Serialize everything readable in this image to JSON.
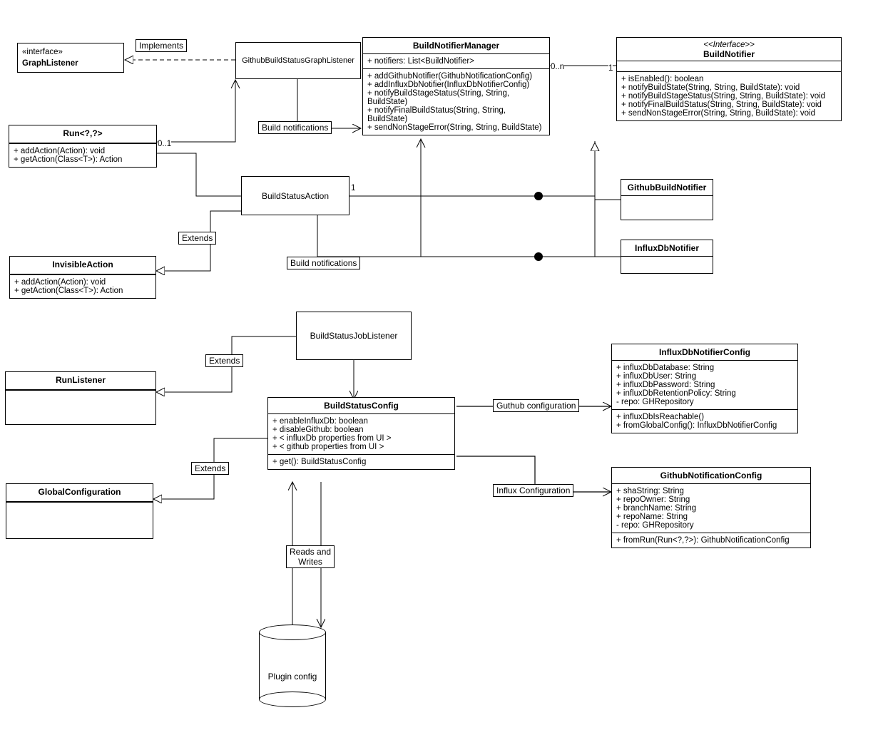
{
  "graphListener": {
    "stereo": "«interface»",
    "name": "GraphListener"
  },
  "implements": "Implements",
  "ghGraphListener": "GithubBuildStatusGraphListener",
  "buildNotifierManager": {
    "name": "BuildNotifierManager",
    "attrs": "+ notifiers: List<BuildNotifier>",
    "ops": [
      "+ addGithubNotifier(GithubNotificationConfig)",
      "+ addInfluxDbNotifier(InfluxDbNotifierConfig)",
      "+ notifyBuildStageStatus(String, String, BuildState)",
      "+ notifyFinalBuildStatus(String, String, BuildState)",
      "+ sendNonStageError(String, String, BuildState)"
    ]
  },
  "multiplicity": {
    "bnmRight": "0..n",
    "bnLeft": "1",
    "bsaRight": "1",
    "runRight": "0..1"
  },
  "buildNotifier": {
    "stereo": "<<Interface>>",
    "name": "BuildNotifier",
    "ops": [
      "+ isEnabled(): boolean",
      "+ notifyBuildState(String, String, BuildState): void",
      "+ notifyBuildStageStatus(String, String, BuildState): void",
      "+ notifyFinalBuildStatus(String, String, BuildState): void",
      "+ sendNonStageError(String, String, BuildState): void"
    ]
  },
  "run": {
    "name": "Run<?,?>",
    "ops": [
      "+ addAction(Action): void",
      "+ getAction(Class<T>): Action"
    ]
  },
  "buildNotifications": "Build notifications",
  "buildStatusAction": "BuildStatusAction",
  "githubBuildNotifier": "GithubBuildNotifier",
  "influxDbNotifier": "InfluxDbNotifier",
  "invisibleAction": {
    "name": "InvisibleAction",
    "ops": [
      "+ addAction(Action): void",
      "+ getAction(Class<T>): Action"
    ]
  },
  "extends": "Extends",
  "buildStatusJobListener": "BuildStatusJobListener",
  "runListener": "RunListener",
  "buildStatusConfig": {
    "name": "BuildStatusConfig",
    "attrs": [
      "+ enableInfluxDb: boolean",
      "+ disableGithub: boolean",
      "+ < influxDb properties from UI >",
      "+ < github properties from UI >"
    ],
    "ops": "+ get(): BuildStatusConfig"
  },
  "githubConfigLabel": "Guthub configuration",
  "influxConfigLabel": "Influx Configuration",
  "influxDbNotifierConfig": {
    "name": "InfluxDbNotifierConfig",
    "attrs": [
      "+ influxDbDatabase: String",
      "+ influxDbUser: String",
      "+ influxDbPassword: String",
      "+ influxDbRetentionPolicy: String",
      "- repo: GHRepository"
    ],
    "ops": [
      "+ influxDbIsReachable()",
      "+ fromGlobalConfig(): InfluxDbNotifierConfig"
    ]
  },
  "githubNotificationConfig": {
    "name": "GithubNotificationConfig",
    "attrs": [
      "+ shaString: String",
      "+ repoOwner: String",
      "+ branchName: String",
      "+ repoName: String",
      "- repo: GHRepository"
    ],
    "ops": "+ fromRun(Run<?,?>): GithubNotificationConfig"
  },
  "globalConfiguration": "GlobalConfiguration",
  "readsWrites": "Reads and\nWrites",
  "pluginConfig": "Plugin config"
}
